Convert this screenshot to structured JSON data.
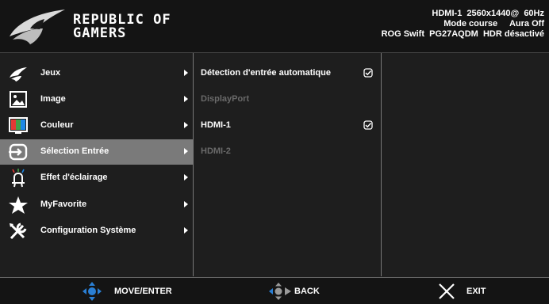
{
  "header": {
    "brand_line1": "REPUBLIC OF",
    "brand_line2": "GAMERS",
    "status_line1": "HDMI-1  2560x1440@  60Hz",
    "status_line2": "Mode course     Aura Off",
    "status_line3": "ROG Swift  PG27AQDM  HDR désactivé"
  },
  "menu": {
    "items": [
      {
        "label": "Jeux",
        "icon": "rog-eye-icon"
      },
      {
        "label": "Image",
        "icon": "image-icon"
      },
      {
        "label": "Couleur",
        "icon": "color-monitor-icon"
      },
      {
        "label": "Sélection Entrée",
        "icon": "input-select-icon",
        "selected": true
      },
      {
        "label": "Effet d'éclairage",
        "icon": "lighting-icon"
      },
      {
        "label": "MyFavorite",
        "icon": "star-icon"
      },
      {
        "label": "Configuration Système",
        "icon": "wrench-screwdriver-icon"
      }
    ]
  },
  "submenu": {
    "items": [
      {
        "label": "Détection d'entrée automatique",
        "checked": true,
        "enabled": true
      },
      {
        "label": "DisplayPort",
        "checked": false,
        "enabled": false
      },
      {
        "label": "HDMI-1",
        "checked": true,
        "enabled": true
      },
      {
        "label": "HDMI-2",
        "checked": false,
        "enabled": false
      }
    ]
  },
  "footer": {
    "move_label": "MOVE/ENTER",
    "back_label": "BACK",
    "exit_label": "EXIT"
  },
  "colors": {
    "accent_blue": "#2a7fd4",
    "selected_bg": "#7a7a7a",
    "disabled_text": "#6a6a6a"
  }
}
